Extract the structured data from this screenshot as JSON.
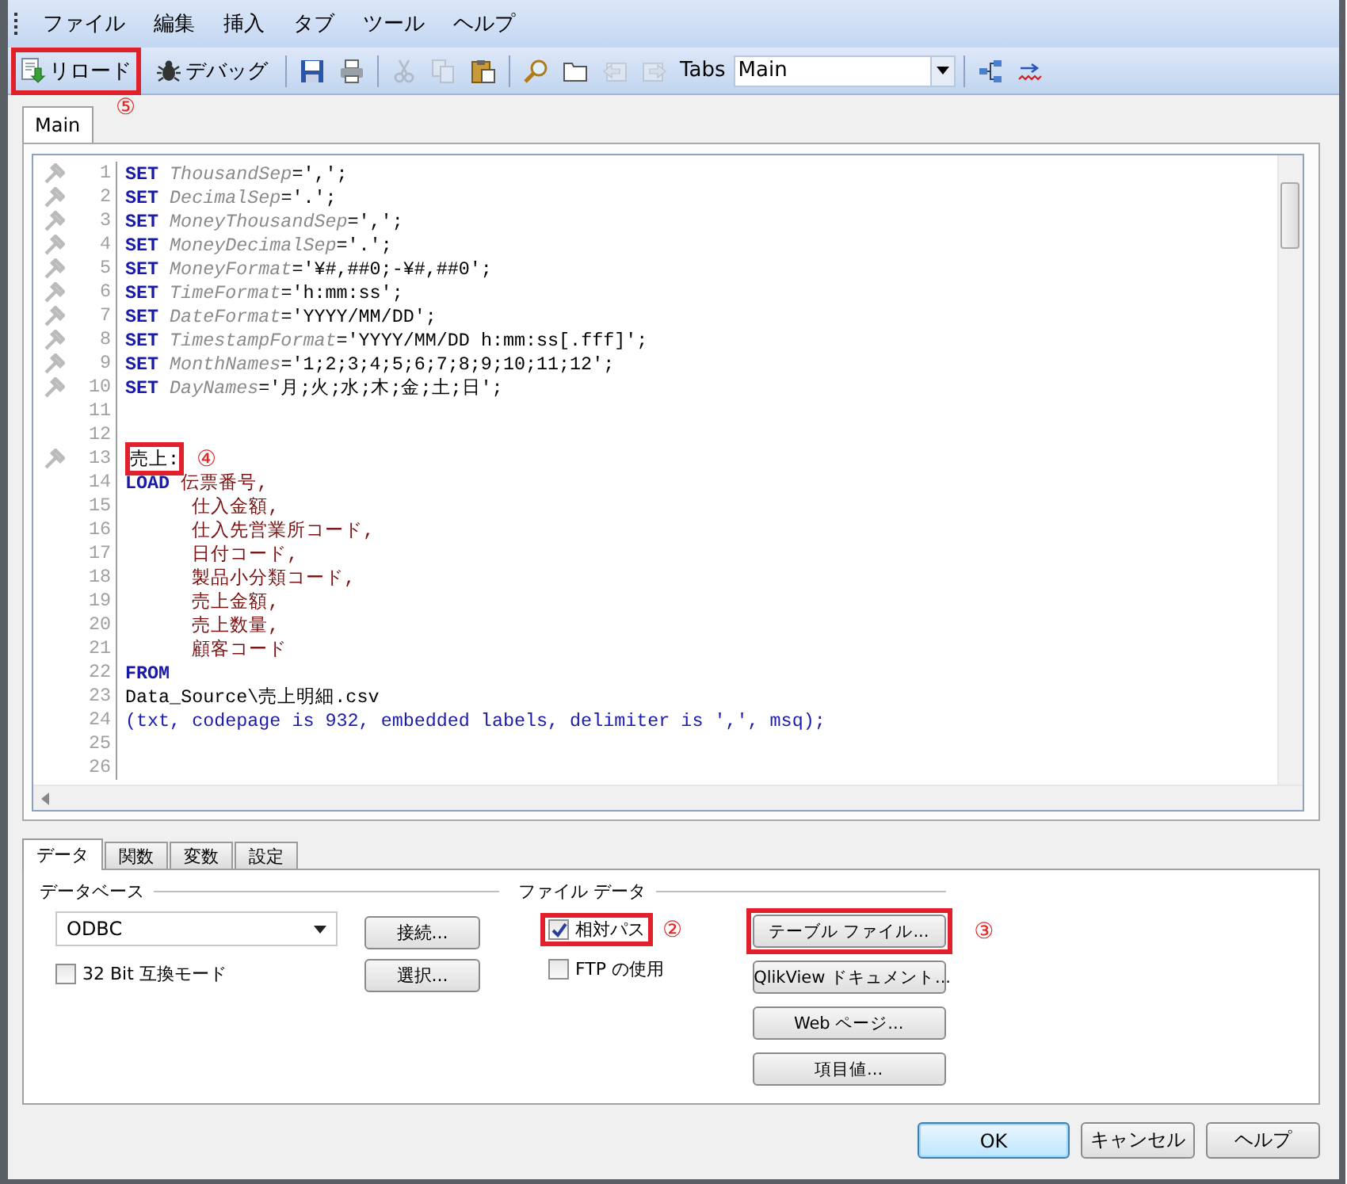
{
  "menu": [
    "ファイル",
    "編集",
    "挿入",
    "タブ",
    "ツール",
    "ヘルプ"
  ],
  "toolbar": [
    {
      "kind": "reload",
      "label": "リロード",
      "highlighted": true,
      "callout": "⑤"
    },
    {
      "kind": "debug",
      "label": "デバッグ",
      "highlighted": false
    },
    {
      "kind": "sep"
    },
    {
      "kind": "save",
      "disabled": false
    },
    {
      "kind": "print",
      "disabled": false
    },
    {
      "kind": "sep"
    },
    {
      "kind": "cut",
      "disabled": true
    },
    {
      "kind": "copy",
      "disabled": true
    },
    {
      "kind": "paste",
      "disabled": false
    },
    {
      "kind": "sep"
    },
    {
      "kind": "find",
      "disabled": false
    },
    {
      "kind": "folder",
      "disabled": false
    },
    {
      "kind": "tab-left",
      "disabled": true
    },
    {
      "kind": "tab-right",
      "disabled": true
    },
    {
      "kind": "label",
      "label": "Tabs"
    },
    {
      "kind": "select",
      "label": "Main"
    },
    {
      "kind": "sep"
    },
    {
      "kind": "tree",
      "disabled": false
    },
    {
      "kind": "wrap",
      "disabled": false
    }
  ],
  "script_tabs": [
    {
      "label": "Main",
      "selected": true
    }
  ],
  "editor": {
    "lines": [
      {
        "number": "1",
        "bookmark": true,
        "segments": [
          {
            "kind": "keyword",
            "text": "SET"
          },
          {
            "kind": "variable",
            "text": "ThousandSep"
          },
          {
            "kind": "plain",
            "text": "=',';"
          }
        ]
      },
      {
        "number": "2",
        "bookmark": true,
        "segments": [
          {
            "kind": "keyword",
            "text": "SET"
          },
          {
            "kind": "variable",
            "text": "DecimalSep"
          },
          {
            "kind": "plain",
            "text": "='.';"
          }
        ]
      },
      {
        "number": "3",
        "bookmark": true,
        "segments": [
          {
            "kind": "keyword",
            "text": "SET"
          },
          {
            "kind": "variable",
            "text": "MoneyThousandSep"
          },
          {
            "kind": "plain",
            "text": "=',';"
          }
        ]
      },
      {
        "number": "4",
        "bookmark": true,
        "segments": [
          {
            "kind": "keyword",
            "text": "SET"
          },
          {
            "kind": "variable",
            "text": "MoneyDecimalSep"
          },
          {
            "kind": "plain",
            "text": "='.';"
          }
        ]
      },
      {
        "number": "5",
        "bookmark": true,
        "segments": [
          {
            "kind": "keyword",
            "text": "SET"
          },
          {
            "kind": "variable",
            "text": "MoneyFormat"
          },
          {
            "kind": "plain",
            "text": "='¥#,##0;-¥#,##0';"
          }
        ]
      },
      {
        "number": "6",
        "bookmark": true,
        "segments": [
          {
            "kind": "keyword",
            "text": "SET"
          },
          {
            "kind": "variable",
            "text": "TimeFormat"
          },
          {
            "kind": "plain",
            "text": "='h:mm:ss';"
          }
        ]
      },
      {
        "number": "7",
        "bookmark": true,
        "segments": [
          {
            "kind": "keyword",
            "text": "SET"
          },
          {
            "kind": "variable",
            "text": "DateFormat"
          },
          {
            "kind": "plain",
            "text": "='YYYY/MM/DD';"
          }
        ]
      },
      {
        "number": "8",
        "bookmark": true,
        "segments": [
          {
            "kind": "keyword",
            "text": "SET"
          },
          {
            "kind": "variable",
            "text": "TimestampFormat"
          },
          {
            "kind": "plain",
            "text": "='YYYY/MM/DD h:mm:ss[.fff]';"
          }
        ]
      },
      {
        "number": "9",
        "bookmark": true,
        "segments": [
          {
            "kind": "keyword",
            "text": "SET"
          },
          {
            "kind": "variable",
            "text": "MonthNames"
          },
          {
            "kind": "plain",
            "text": "='1;2;3;4;5;6;7;8;9;10;11;12';"
          }
        ]
      },
      {
        "number": "10",
        "bookmark": true,
        "segments": [
          {
            "kind": "keyword",
            "text": "SET"
          },
          {
            "kind": "variable",
            "text": "DayNames"
          },
          {
            "kind": "plain",
            "text": "='月;火;水;木;金;土;日';"
          }
        ]
      },
      {
        "number": "11",
        "bookmark": false
      },
      {
        "number": "12",
        "bookmark": false
      },
      {
        "number": "13",
        "bookmark": true,
        "segments": [
          {
            "kind": "label",
            "text": "売上:",
            "highlighted": true,
            "callout": "④"
          }
        ]
      },
      {
        "number": "14",
        "bookmark": false,
        "segments": [
          {
            "kind": "keyword",
            "text": "LOAD"
          },
          {
            "kind": "field",
            "text": "伝票番号,"
          }
        ]
      },
      {
        "number": "15",
        "bookmark": false,
        "continuation": true,
        "segments": [
          {
            "kind": "field",
            "text": "仕入金額,"
          }
        ]
      },
      {
        "number": "16",
        "bookmark": false,
        "continuation": true,
        "segments": [
          {
            "kind": "field",
            "text": "仕入先営業所コード,"
          }
        ]
      },
      {
        "number": "17",
        "bookmark": false,
        "continuation": true,
        "segments": [
          {
            "kind": "field",
            "text": "日付コード,"
          }
        ]
      },
      {
        "number": "18",
        "bookmark": false,
        "continuation": true,
        "segments": [
          {
            "kind": "field",
            "text": "製品小分類コード,"
          }
        ]
      },
      {
        "number": "19",
        "bookmark": false,
        "continuation": true,
        "segments": [
          {
            "kind": "field",
            "text": "売上金額,"
          }
        ]
      },
      {
        "number": "20",
        "bookmark": false,
        "continuation": true,
        "segments": [
          {
            "kind": "field",
            "text": "売上数量,"
          }
        ]
      },
      {
        "number": "21",
        "bookmark": false,
        "continuation": true,
        "segments": [
          {
            "kind": "field",
            "text": "顧客コード"
          }
        ]
      },
      {
        "number": "22",
        "bookmark": false,
        "segments": [
          {
            "kind": "keyword",
            "text": "FROM"
          }
        ]
      },
      {
        "number": "23",
        "bookmark": false,
        "segments": [
          {
            "kind": "plain",
            "text": "Data_Source\\売上明細.csv"
          }
        ]
      },
      {
        "number": "24",
        "bookmark": false,
        "segments": [
          {
            "kind": "option",
            "text": "(txt, codepage is 932, embedded labels, delimiter is ',', msq);"
          }
        ]
      },
      {
        "number": "25",
        "bookmark": false
      },
      {
        "number": "26",
        "bookmark": false
      }
    ]
  },
  "panel_tabs": [
    {
      "label": "データ",
      "selected": true
    },
    {
      "label": "関数",
      "selected": false
    },
    {
      "label": "変数",
      "selected": false
    },
    {
      "label": "設定",
      "selected": false
    }
  ],
  "database": {
    "legend": "データベース",
    "select": "ODBC",
    "checkbox": {
      "label": "32 Bit 互換モード",
      "checked": false
    },
    "buttons": [
      "接続...",
      "選択..."
    ]
  },
  "file_data": {
    "legend": "ファイル データ",
    "checkboxes": [
      {
        "label": "相対パス",
        "checked": true,
        "highlighted": true,
        "callout": "②"
      },
      {
        "label": "FTP の使用",
        "checked": false,
        "highlighted": false
      }
    ],
    "buttons": [
      {
        "label": "テーブル ファイル...",
        "highlighted": true,
        "callout": "③"
      },
      {
        "label": "QlikView ドキュメント...",
        "highlighted": false
      },
      {
        "label": "Web ページ...",
        "highlighted": false
      },
      {
        "label": "項目値...",
        "highlighted": false
      }
    ]
  },
  "footer": [
    {
      "label": "OK",
      "default": true
    },
    {
      "label": "キャンセル",
      "default": false
    },
    {
      "label": "ヘルプ",
      "default": false
    }
  ]
}
